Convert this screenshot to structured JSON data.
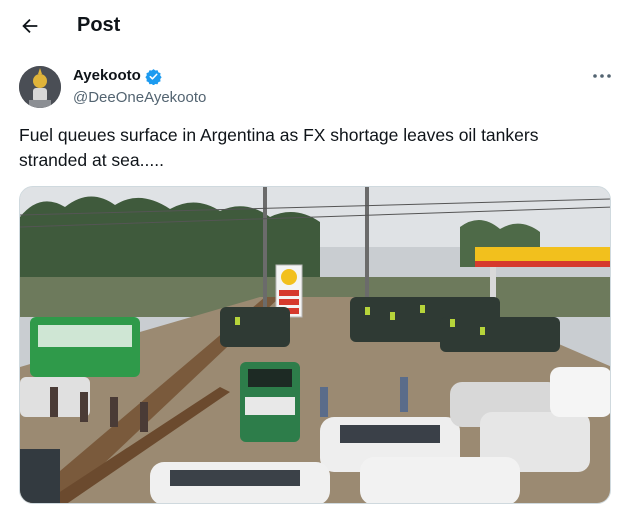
{
  "header": {
    "title": "Post"
  },
  "author": {
    "display_name": "Ayekooto",
    "handle": "@DeeOneAyekooto",
    "verified": true
  },
  "post": {
    "text_line1": "Fuel queues surface in Argentina as FX shortage leaves oil tankers",
    "text_line2": "stranded at sea....."
  },
  "media": {
    "sign_text": "SHELL"
  },
  "colors": {
    "accent": "#1d9bf0",
    "text": "#0f1419",
    "secondary": "#536471"
  },
  "icons": {
    "back": "arrow-left-icon",
    "verified": "verified-badge-icon",
    "more": "more-horizontal-icon"
  }
}
